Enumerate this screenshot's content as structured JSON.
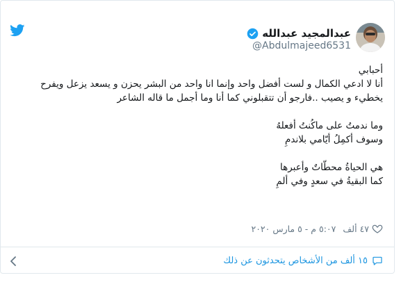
{
  "tweet": {
    "author_name": "عبدالمجيد عبدالله",
    "handle": "@Abdulmajeed6531",
    "lines": [
      "أحبابي",
      "أنا لا ادعي الكمال و لست أفضل واحد وإنما انا واحد من البشر يحزن و يسعد يزعل ويفرح",
      "يخطيء و يصيب ..فارجو أن تتقبلوني كما أنا وما أجمل ما قاله الشاعر",
      "",
      "وما ندمتُ على ماكُنتُ أفعلهُ",
      "وسوف أكمِلُ أيّامي بلاندمِ",
      "",
      "هي الحياةُ محطّاتٌ وأعبرها",
      "كما البقيةُ في سعدٍ وفي ألمِ"
    ],
    "timestamp": "٥:٠٧ م - ٥ مارس ٢٠٢٠",
    "likes": "٤٧ ألف",
    "conversation_text": "١٥ ألف من الأشخاص يتحدثون عن ذلك"
  },
  "colors": {
    "twitter_blue": "#1da1f2",
    "link_blue": "#1b95e0",
    "muted": "#657786",
    "text": "#14171a"
  },
  "icons": {
    "logo": "twitter-bird-icon",
    "verified": "verified-badge-icon",
    "like": "heart-icon",
    "conversation": "speech-bubble-icon",
    "chevron": "chevron-left-icon"
  }
}
